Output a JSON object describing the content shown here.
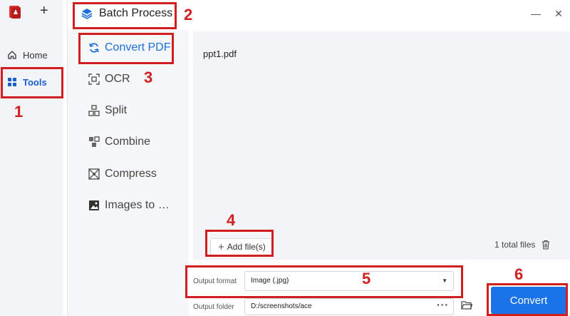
{
  "rail": {
    "items": [
      {
        "label": "Home",
        "icon": "home-icon"
      },
      {
        "label": "Tools",
        "icon": "tools-grid-icon"
      }
    ],
    "new_tab_icon": "plus-icon"
  },
  "dialog": {
    "title": "Batch Process",
    "menu": [
      {
        "label": "Convert PDF",
        "icon": "convert-icon"
      },
      {
        "label": "OCR",
        "icon": "ocr-icon"
      },
      {
        "label": "Split",
        "icon": "split-icon"
      },
      {
        "label": "Combine",
        "icon": "combine-icon"
      },
      {
        "label": "Compress",
        "icon": "compress-icon"
      },
      {
        "label": "Images to …",
        "icon": "images-icon"
      }
    ],
    "files": [
      "ppt1.pdf"
    ],
    "add_files_label": "Add file(s)",
    "total_files": "1 total files",
    "output_format_label": "Output format",
    "output_format_value": "Image (.jpg)",
    "output_folder_label": "Output folder",
    "output_folder_value": "D:/screenshots/ace",
    "convert_label": "Convert"
  },
  "annotations": [
    "1",
    "2",
    "3",
    "4",
    "5",
    "6"
  ],
  "colors": {
    "accent": "#1a73e8",
    "annotation": "#d11f1f"
  }
}
